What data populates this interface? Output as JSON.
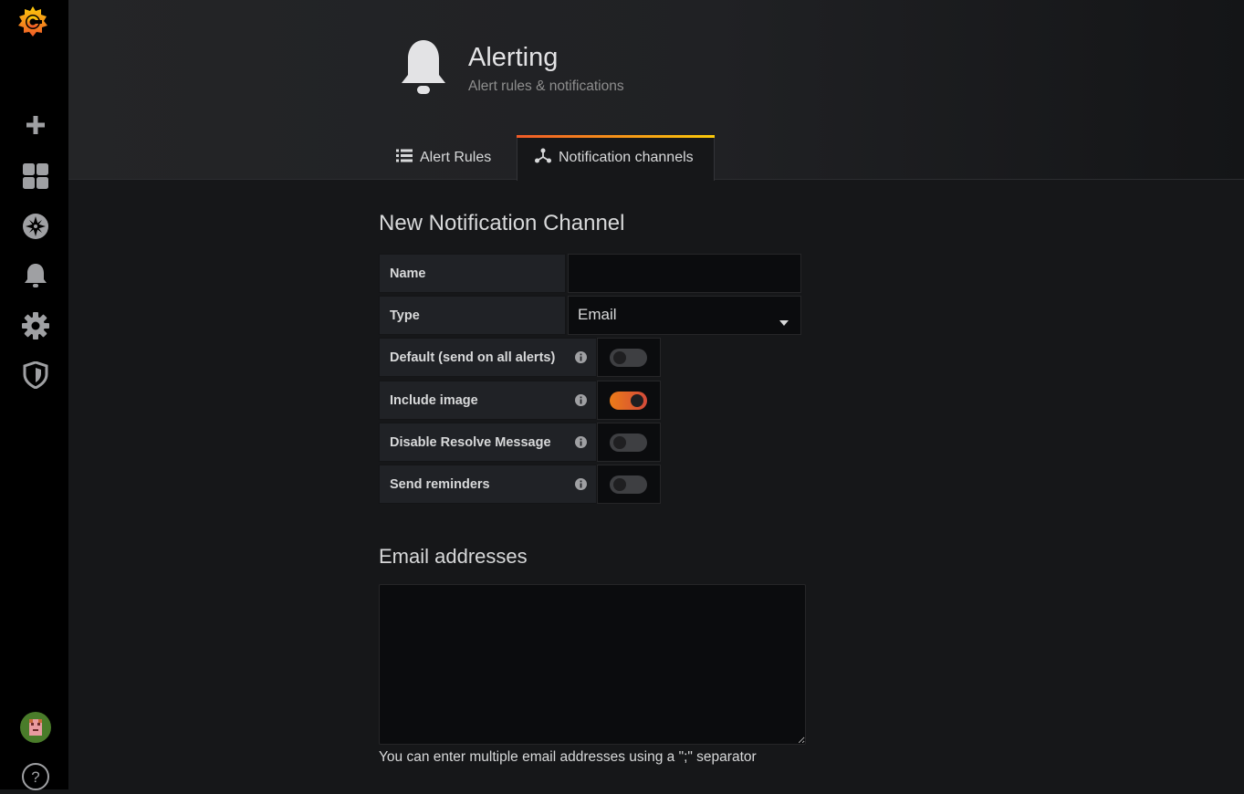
{
  "sidebar": {
    "items": [
      {
        "icon": "grafana-logo-icon"
      },
      {
        "icon": "plus-icon"
      },
      {
        "icon": "dashboards-icon"
      },
      {
        "icon": "explore-compass-icon"
      },
      {
        "icon": "bell-icon"
      },
      {
        "icon": "gear-icon"
      },
      {
        "icon": "shield-icon"
      },
      {
        "icon": "user-avatar"
      },
      {
        "icon": "help-icon"
      }
    ]
  },
  "header": {
    "title": "Alerting",
    "subtitle": "Alert rules & notifications",
    "icon": "bell-icon"
  },
  "tabs": [
    {
      "label": "Alert Rules",
      "icon": "list-icon",
      "active": false
    },
    {
      "label": "Notification channels",
      "icon": "channels-icon",
      "active": true
    }
  ],
  "form": {
    "title": "New Notification Channel",
    "name_label": "Name",
    "name_value": "",
    "type_label": "Type",
    "type_value": "Email",
    "toggles": [
      {
        "label": "Default (send on all alerts)",
        "on": false
      },
      {
        "label": "Include image",
        "on": true
      },
      {
        "label": "Disable Resolve Message",
        "on": false
      },
      {
        "label": "Send reminders",
        "on": false
      }
    ]
  },
  "email": {
    "section_title": "Email addresses",
    "value": "",
    "hint": "You can enter multiple email addresses using a \";\" separator"
  },
  "colors": {
    "accent_orange": "#eb7b18",
    "accent_gradient_start": "#f05a28",
    "accent_gradient_end": "#fbca0a",
    "background": "#161719",
    "sidebar": "#000000"
  }
}
